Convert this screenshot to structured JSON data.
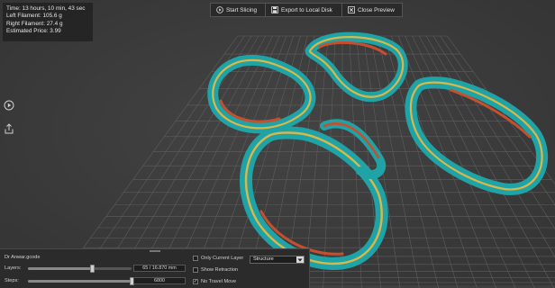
{
  "info": {
    "time": "Time: 13 hours, 10 min, 43 sec",
    "left_filament": "Left Filament: 105.6 g",
    "right_filament": "Right Filament: 27.4 g",
    "price": "Estimated Price: 3.99"
  },
  "toolbar": {
    "start_slicing": "Start Slicing",
    "export": "Export to Local Disk",
    "close_preview": "Close Preview"
  },
  "side": {
    "icons": [
      "play-circle-icon",
      "share-upload-icon"
    ]
  },
  "bottom": {
    "gcode_name": "Dr Anwar.gcode",
    "layers_label": "Layers:",
    "layers_value": "65 / 16.870 mm",
    "layers_fraction": 0.62,
    "steps_label": "Steps:",
    "steps_value": "6800",
    "steps_fraction": 1.0,
    "only_current_layer": "Only Current Layer",
    "show_retraction": "Show Retraction",
    "no_travel_move": "No Travel Move",
    "structure_option": "Structure",
    "checks": {
      "only_current_layer": false,
      "show_retraction": false,
      "no_travel_move": true
    }
  },
  "colors": {
    "background": "#3a3a3a",
    "grid": "#5e5e5e",
    "wall_teal": "#1fa3a6",
    "infill_yellow": "#d9b84a",
    "support_orange": "#c5502f",
    "panel": "#2b2b2b"
  }
}
